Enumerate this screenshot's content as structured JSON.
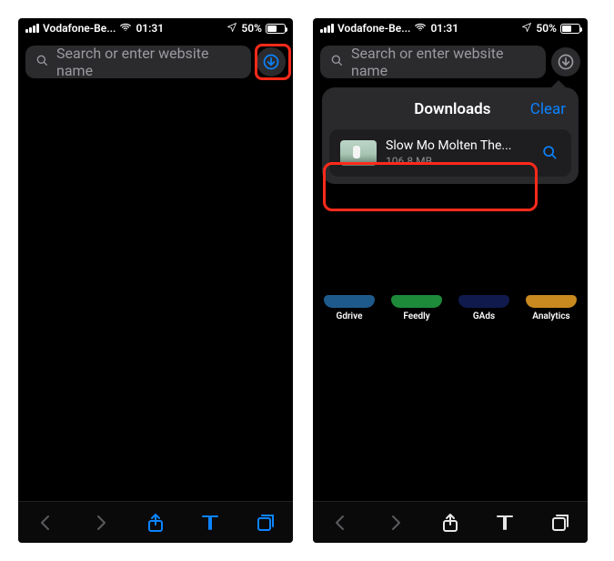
{
  "status": {
    "carrier": "Vodafone-Be...",
    "time": "01:31",
    "battery_pct": "50%"
  },
  "urlbar": {
    "placeholder": "Search or enter website name"
  },
  "downloads": {
    "title": "Downloads",
    "clear": "Clear",
    "items": [
      {
        "name": "Slow Mo Molten The...",
        "size": "106.8 MB"
      }
    ]
  },
  "favorites": [
    {
      "label": "Gdrive"
    },
    {
      "label": "Feedly"
    },
    {
      "label": "GAds"
    },
    {
      "label": "Analytics"
    }
  ],
  "icons": {
    "search": "search-icon",
    "download": "download-icon",
    "back": "back-icon",
    "forward": "forward-icon",
    "share": "share-icon",
    "bookmarks": "bookmarks-icon",
    "tabs": "tabs-icon",
    "location": "location-icon",
    "wifi": "wifi-icon",
    "magnify": "magnify-icon"
  }
}
